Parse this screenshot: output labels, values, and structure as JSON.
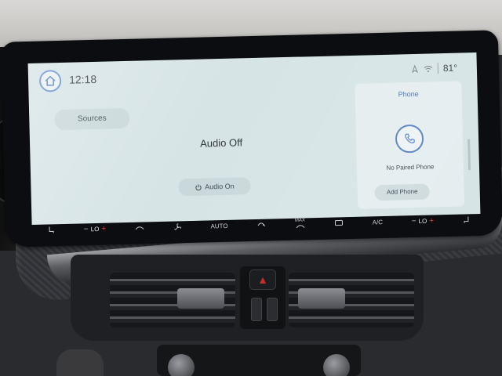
{
  "status_bar": {
    "time": "12:18",
    "outside_temp": "81°",
    "icons": [
      "home-icon",
      "compass-icon",
      "wifi-icon"
    ]
  },
  "audio": {
    "sources_label": "Sources",
    "state_label": "Audio Off",
    "audio_on_label": "Audio On"
  },
  "phone": {
    "title": "Phone",
    "status": "No Paired Phone",
    "add_label": "Add Phone"
  },
  "climate_bar": {
    "left_temp": "LO",
    "right_temp": "LO",
    "auto_label": "AUTO",
    "max_label": "MAX",
    "ac_label": "A/C",
    "icons": [
      "seat-heat-icon",
      "fan-icon",
      "defrost-icon",
      "max-defrost-icon",
      "rear-defrost-icon",
      "seat-heat-right-icon"
    ]
  },
  "colors": {
    "screen_bg": "#d6e4e6",
    "accent_blue": "#5a82c4",
    "plus_red": "#d2403a"
  }
}
